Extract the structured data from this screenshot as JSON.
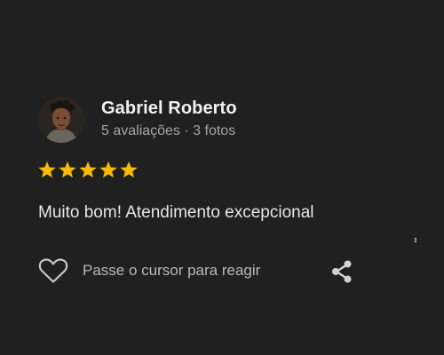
{
  "review": {
    "reviewer_name": "Gabriel Roberto",
    "reviewer_meta": "5 avaliações · 3 fotos",
    "rating": 5,
    "rating_max": 5,
    "text": "Muito bom! Atendimento excepcional"
  },
  "actions": {
    "react_label": "Passe o cursor para reagir",
    "react_icon": "heart-outline-icon",
    "share_icon": "share-icon"
  },
  "colors": {
    "background": "#202020",
    "star": "#f6bb06",
    "name": "#f1f1f1",
    "meta": "#a3a3a3"
  }
}
